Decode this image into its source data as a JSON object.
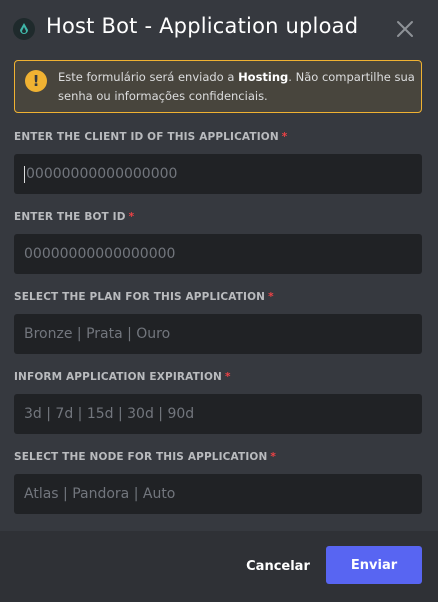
{
  "modal": {
    "title": "Host Bot - Application upload",
    "app_icon": "bot-avatar-icon",
    "close_icon": "close-icon"
  },
  "warning": {
    "icon": "exclamation-icon",
    "text_prefix": "Este formulário será enviado a ",
    "text_bold": "Hosting",
    "text_suffix": ". Não compartilhe sua senha ou informações confidenciais."
  },
  "form": {
    "fields": [
      {
        "label": "ENTER THE CLIENT ID OF THIS APPLICATION",
        "required": "*",
        "placeholder": "00000000000000000"
      },
      {
        "label": "ENTER THE BOT ID",
        "required": "*",
        "placeholder": "00000000000000000"
      },
      {
        "label": "SELECT THE PLAN FOR THIS APPLICATION",
        "required": "*",
        "placeholder": "Bronze | Prata | Ouro"
      },
      {
        "label": "INFORM APPLICATION EXPIRATION",
        "required": "*",
        "placeholder": "3d | 7d | 15d | 30d | 90d"
      },
      {
        "label": "SELECT THE NODE FOR THIS APPLICATION",
        "required": "*",
        "placeholder": "Atlas | Pandora | Auto"
      }
    ]
  },
  "footer": {
    "cancel_label": "Cancelar",
    "submit_label": "Enviar"
  },
  "colors": {
    "background": "#36393f",
    "input": "#202225",
    "footer": "#2f3136",
    "warning": "#f0b232",
    "primary": "#5865f2",
    "required": "#ed4245"
  }
}
